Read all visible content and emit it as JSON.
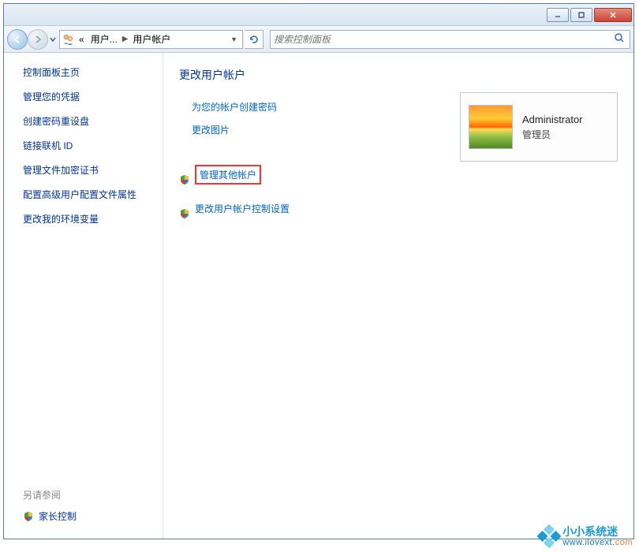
{
  "titlebar": {
    "title": ""
  },
  "breadcrumb": {
    "sep_prefix": "«",
    "crumb1": "用户...",
    "crumb2": "用户帐户"
  },
  "search": {
    "placeholder": "搜索控制面板"
  },
  "sidebar": {
    "heading": "控制面板主页",
    "links": [
      "管理您的凭据",
      "创建密码重设盘",
      "链接联机 ID",
      "管理文件加密证书",
      "配置高级用户配置文件属性",
      "更改我的环境变量"
    ],
    "footer_heading": "另请参阅",
    "footer_link": "家长控制"
  },
  "main": {
    "title": "更改用户帐户",
    "group1": [
      "为您的帐户创建密码",
      "更改图片"
    ],
    "group2": [
      "管理其他帐户",
      "更改用户帐户控制设置"
    ]
  },
  "account": {
    "name": "Administrator",
    "role": "管理员"
  },
  "watermark": {
    "cn": "小小系统迷",
    "en_prefix": "www.ilovext.",
    "en_suffix": "com"
  }
}
